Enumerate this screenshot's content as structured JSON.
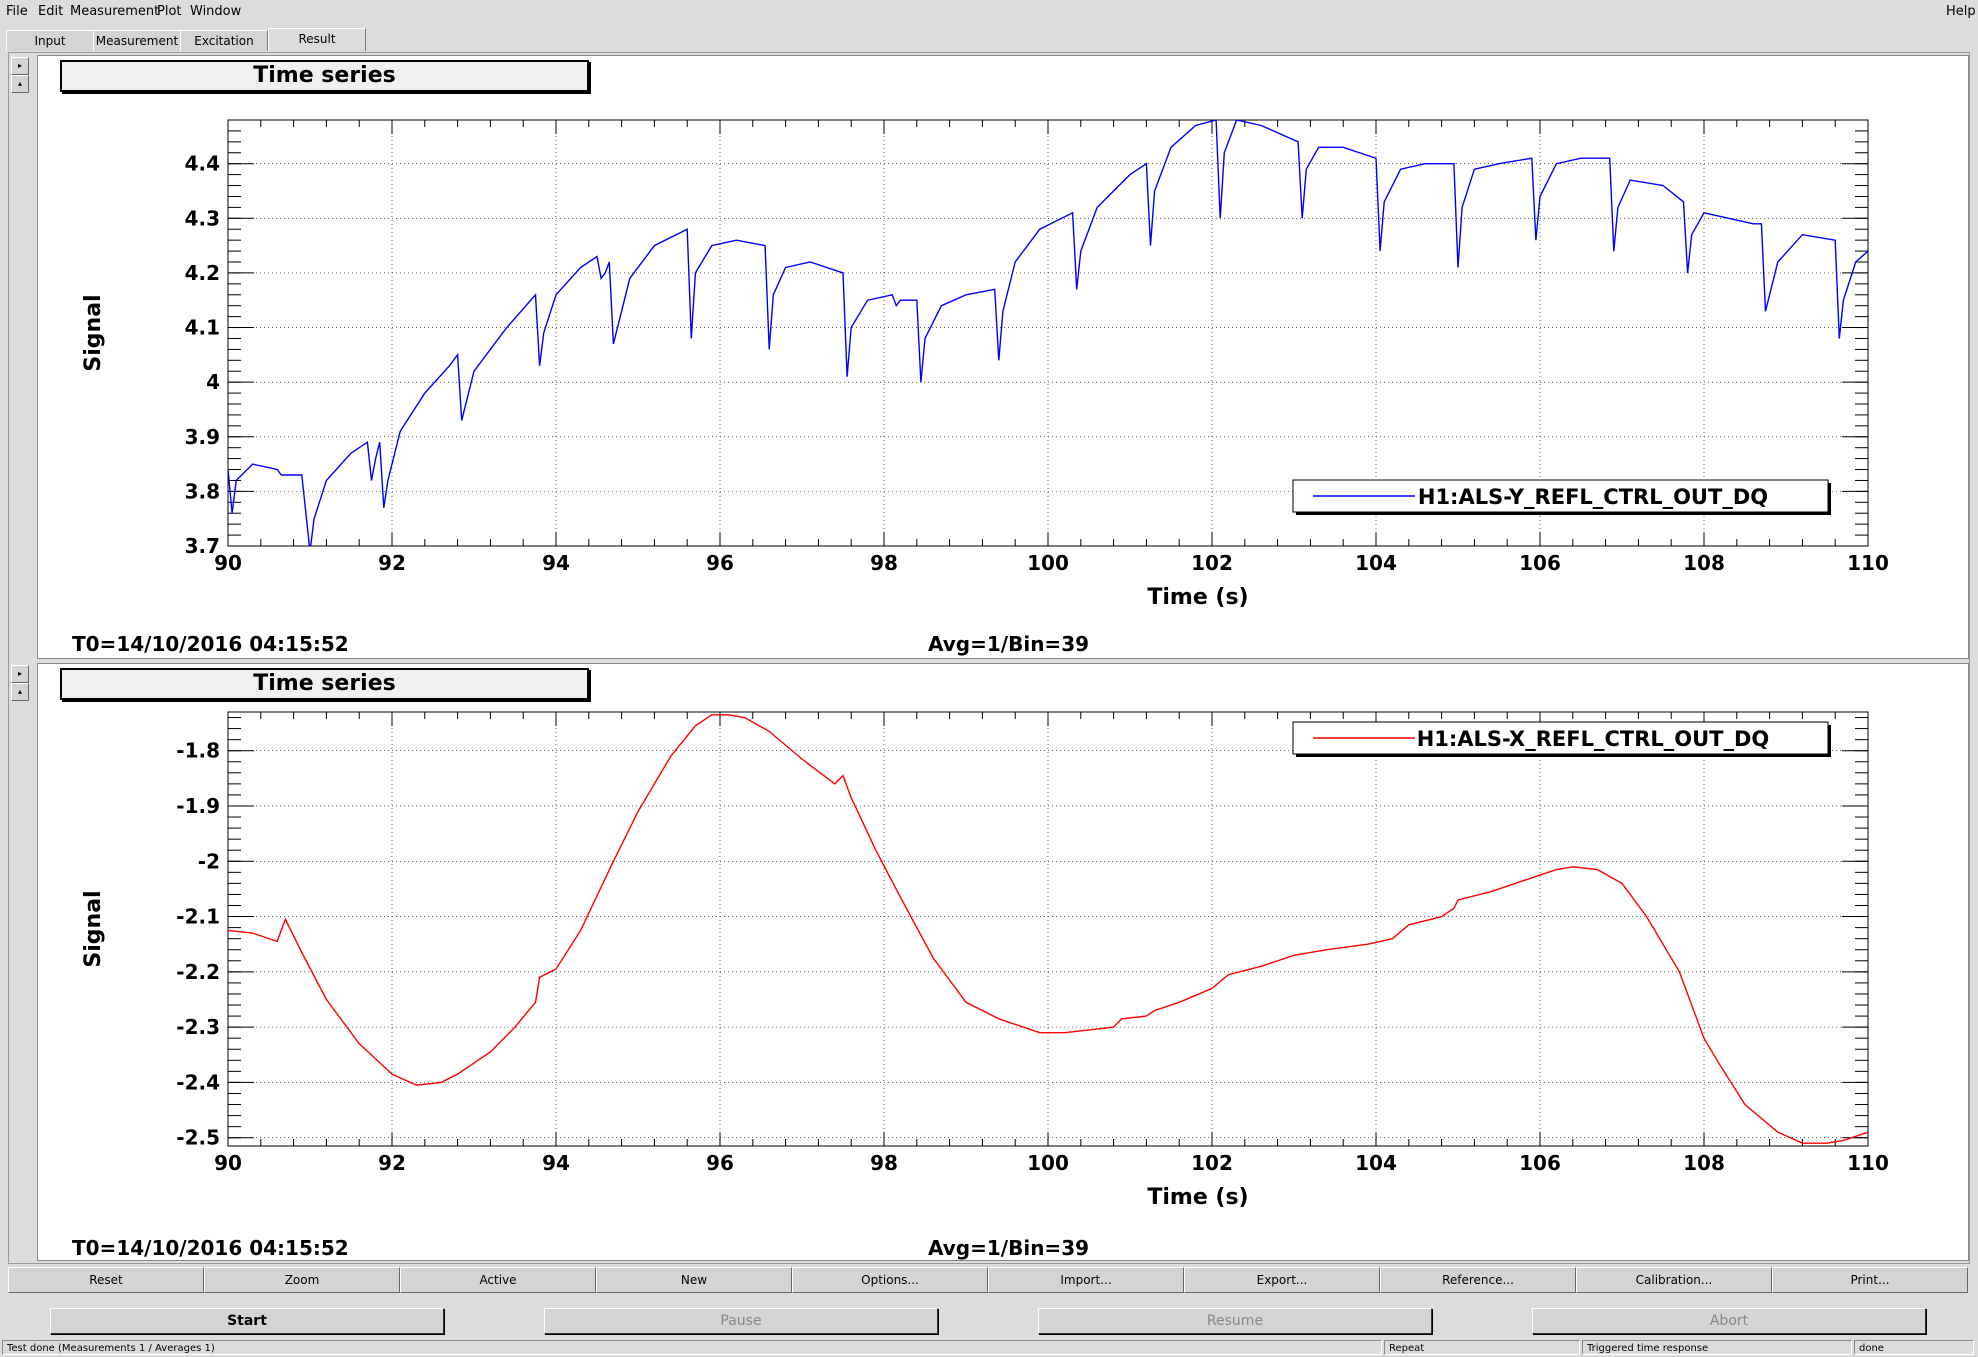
{
  "menu": {
    "items": [
      "File",
      "Edit",
      "Measurement",
      "Plot",
      "Window"
    ],
    "help": "Help"
  },
  "tabs": [
    {
      "label": "Input"
    },
    {
      "label": "Measurement"
    },
    {
      "label": "Excitation"
    },
    {
      "label": "Result",
      "active": true
    }
  ],
  "plots": [
    {
      "title": "Time series",
      "t0": "T0=14/10/2016 04:15:52",
      "avg": "Avg=1/Bin=39"
    },
    {
      "title": "Time series",
      "t0": "T0=14/10/2016 04:15:52",
      "avg": "Avg=1/Bin=39"
    }
  ],
  "chart_data": [
    {
      "type": "line",
      "xlabel": "Time (s)",
      "ylabel": "Signal",
      "xlim": [
        90,
        110
      ],
      "ylim": [
        3.7,
        4.48
      ],
      "xticks": [
        90,
        92,
        94,
        96,
        98,
        100,
        102,
        104,
        106,
        108,
        110
      ],
      "yticks": [
        "3.7",
        "3.8",
        "3.9",
        "4",
        "4.1",
        "4.2",
        "4.3",
        "4.4"
      ],
      "grid": true,
      "legend": "bottom-right",
      "series": [
        {
          "name": "H1:ALS-Y_REFL_CTRL_OUT_DQ",
          "color": "#0000ff",
          "x": [
            90.0,
            90.05,
            90.1,
            90.3,
            90.6,
            90.65,
            90.9,
            91.0,
            91.05,
            91.2,
            91.5,
            91.7,
            91.75,
            91.8,
            91.85,
            91.9,
            91.95,
            92.1,
            92.4,
            92.7,
            92.8,
            92.85,
            93.0,
            93.4,
            93.75,
            93.8,
            93.85,
            94.0,
            94.3,
            94.5,
            94.55,
            94.6,
            94.65,
            94.7,
            94.9,
            95.2,
            95.6,
            95.65,
            95.7,
            95.9,
            96.2,
            96.55,
            96.6,
            96.65,
            96.8,
            97.1,
            97.5,
            97.55,
            97.6,
            97.8,
            98.1,
            98.15,
            98.2,
            98.4,
            98.45,
            98.5,
            98.7,
            99.0,
            99.35,
            99.4,
            99.45,
            99.6,
            99.9,
            100.3,
            100.35,
            100.4,
            100.6,
            101.0,
            101.2,
            101.25,
            101.3,
            101.5,
            101.8,
            102.05,
            102.1,
            102.15,
            102.3,
            102.6,
            103.05,
            103.1,
            103.15,
            103.3,
            103.6,
            104.0,
            104.05,
            104.1,
            104.3,
            104.6,
            104.95,
            105.0,
            105.05,
            105.2,
            105.5,
            105.9,
            105.95,
            106.0,
            106.2,
            106.5,
            106.85,
            106.9,
            106.95,
            107.1,
            107.5,
            107.75,
            107.8,
            107.85,
            108.0,
            108.3,
            108.6,
            108.7,
            108.75,
            108.9,
            109.2,
            109.6,
            109.65,
            109.7,
            109.85,
            110.0
          ],
          "y": [
            3.84,
            3.76,
            3.82,
            3.85,
            3.84,
            3.83,
            3.83,
            3.69,
            3.75,
            3.82,
            3.87,
            3.89,
            3.82,
            3.86,
            3.89,
            3.77,
            3.82,
            3.91,
            3.98,
            4.03,
            4.05,
            3.93,
            4.02,
            4.1,
            4.16,
            4.03,
            4.09,
            4.16,
            4.21,
            4.23,
            4.19,
            4.2,
            4.22,
            4.07,
            4.19,
            4.25,
            4.28,
            4.08,
            4.2,
            4.25,
            4.26,
            4.25,
            4.06,
            4.16,
            4.21,
            4.22,
            4.2,
            4.01,
            4.1,
            4.15,
            4.16,
            4.14,
            4.15,
            4.15,
            4.0,
            4.08,
            4.14,
            4.16,
            4.17,
            4.04,
            4.13,
            4.22,
            4.28,
            4.31,
            4.17,
            4.24,
            4.32,
            4.38,
            4.4,
            4.25,
            4.35,
            4.43,
            4.47,
            4.48,
            4.3,
            4.42,
            4.48,
            4.47,
            4.44,
            4.3,
            4.39,
            4.43,
            4.43,
            4.41,
            4.24,
            4.33,
            4.39,
            4.4,
            4.4,
            4.21,
            4.32,
            4.39,
            4.4,
            4.41,
            4.26,
            4.34,
            4.4,
            4.41,
            4.41,
            4.24,
            4.32,
            4.37,
            4.36,
            4.33,
            4.2,
            4.27,
            4.31,
            4.3,
            4.29,
            4.29,
            4.13,
            4.22,
            4.27,
            4.26,
            4.08,
            4.15,
            4.22,
            4.24
          ]
        }
      ]
    },
    {
      "type": "line",
      "xlabel": "Time (s)",
      "ylabel": "Signal",
      "xlim": [
        90,
        110
      ],
      "ylim": [
        -2.515,
        -1.73
      ],
      "xticks": [
        90,
        92,
        94,
        96,
        98,
        100,
        102,
        104,
        106,
        108,
        110
      ],
      "yticks": [
        "-2.5",
        "-2.4",
        "-2.3",
        "-2.2",
        "-2.1",
        "-2",
        "-1.9",
        "-1.8"
      ],
      "grid": true,
      "legend": "top-right",
      "series": [
        {
          "name": "H1:ALS-X_REFL_CTRL_OUT_DQ",
          "color": "#ff0000",
          "x": [
            90.0,
            90.3,
            90.6,
            90.7,
            90.9,
            91.2,
            91.6,
            92.0,
            92.3,
            92.6,
            92.8,
            92.9,
            93.2,
            93.5,
            93.75,
            93.8,
            94.0,
            94.3,
            94.7,
            95.0,
            95.4,
            95.7,
            95.9,
            96.1,
            96.3,
            96.6,
            97.0,
            97.4,
            97.5,
            97.6,
            97.9,
            98.2,
            98.6,
            99.0,
            99.4,
            99.6,
            99.9,
            100.2,
            100.5,
            100.8,
            100.9,
            101.2,
            101.3,
            101.6,
            102.0,
            102.2,
            102.6,
            103.0,
            103.4,
            103.9,
            104.2,
            104.4,
            104.8,
            104.95,
            105.0,
            105.4,
            105.8,
            106.2,
            106.4,
            106.7,
            107.0,
            107.3,
            107.7,
            108.0,
            108.2,
            108.5,
            108.9,
            109.2,
            109.5,
            109.7,
            110.0
          ],
          "y": [
            -2.125,
            -2.13,
            -2.145,
            -2.105,
            -2.165,
            -2.25,
            -2.33,
            -2.385,
            -2.405,
            -2.4,
            -2.385,
            -2.375,
            -2.345,
            -2.3,
            -2.255,
            -2.21,
            -2.195,
            -2.125,
            -2.0,
            -1.91,
            -1.81,
            -1.755,
            -1.735,
            -1.735,
            -1.74,
            -1.765,
            -1.815,
            -1.86,
            -1.845,
            -1.885,
            -1.98,
            -2.065,
            -2.175,
            -2.255,
            -2.285,
            -2.295,
            -2.31,
            -2.31,
            -2.305,
            -2.3,
            -2.285,
            -2.28,
            -2.27,
            -2.255,
            -2.23,
            -2.205,
            -2.19,
            -2.17,
            -2.16,
            -2.15,
            -2.14,
            -2.115,
            -2.1,
            -2.085,
            -2.07,
            -2.055,
            -2.035,
            -2.015,
            -2.01,
            -2.015,
            -2.04,
            -2.1,
            -2.2,
            -2.32,
            -2.37,
            -2.44,
            -2.49,
            -2.51,
            -2.51,
            -2.505,
            -2.49
          ]
        }
      ]
    }
  ],
  "buttons": [
    "Reset",
    "Zoom",
    "Active",
    "New",
    "Options...",
    "Import...",
    "Export...",
    "Reference...",
    "Calibration...",
    "Print..."
  ],
  "control": {
    "start": "Start",
    "pause": "Pause",
    "resume": "Resume",
    "abort": "Abort"
  },
  "status": {
    "message": "Test done (Measurements 1 / Averages 1)",
    "repeat": "Repeat",
    "mode": "Triggered time response",
    "state": "done"
  }
}
